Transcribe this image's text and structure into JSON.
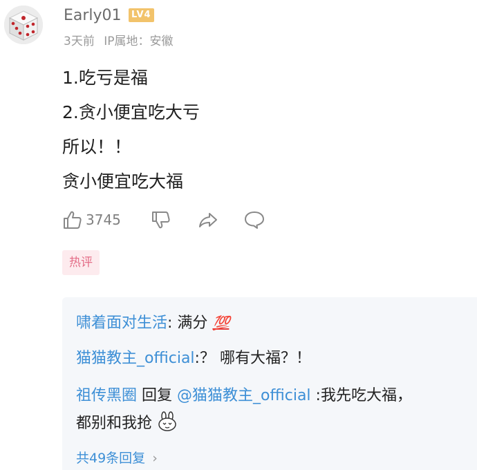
{
  "comment": {
    "username": "Early01",
    "level_badge": "LV4",
    "time": "3天前",
    "ip_location": "IP属地：安徽",
    "lines": [
      "1.吃亏是福",
      "2.贪小便宜吃大亏",
      "所以！！",
      "贪小便宜吃大福"
    ],
    "likes": "3745",
    "tag": "热评"
  },
  "replies": {
    "items": [
      {
        "name": "啸着面对生活",
        "separator": ": ",
        "text": "满分",
        "emoji": "💯"
      },
      {
        "name": "猫猫教主_official",
        "separator": ":",
        "text": "？ 哪有大福？！"
      },
      {
        "name": "祖传黑圈",
        "reply_word": " 回复 ",
        "mention": "@猫猫教主_official",
        "separator": " :",
        "text_line1": "我先吃大福，",
        "text_line2": "都别和我抢"
      }
    ],
    "more_label": "共49条回复",
    "more_arrow": "›"
  },
  "icons": {
    "avatar": "dice-avatar",
    "like": "thumbs-up-icon",
    "dislike": "thumbs-down-icon",
    "share": "share-arrow-icon",
    "comment": "comment-bubble-icon",
    "sticker": "bunny-sticker-icon"
  },
  "colors": {
    "link_blue": "#3d8fd6",
    "level_badge": "#f2c36b",
    "hot_tag_bg": "#fdebee",
    "hot_tag_text": "#e46e88",
    "reply_bg": "#f5f7fa"
  }
}
